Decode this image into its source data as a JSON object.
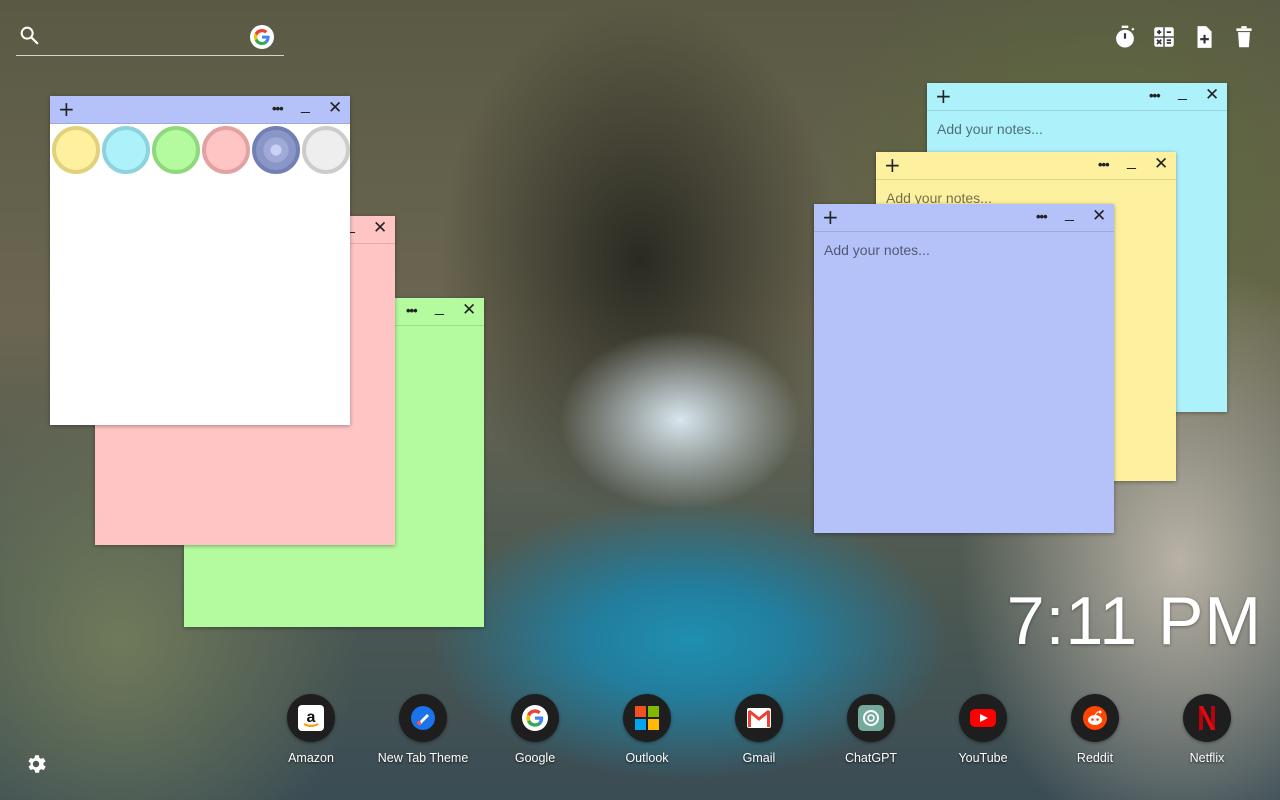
{
  "search": {
    "placeholder": "",
    "icon": "search-icon",
    "engine_icon": "google-icon"
  },
  "toolbar": [
    {
      "name": "timer",
      "icon": "stopwatch-icon"
    },
    {
      "name": "calculator",
      "icon": "calculator-icon"
    },
    {
      "name": "new-note",
      "icon": "new-file-icon"
    },
    {
      "name": "delete",
      "icon": "trash-icon"
    }
  ],
  "notes": {
    "placeholder": "Add your notes...",
    "add_label": "+",
    "more_label": "•••",
    "minimize_label": "_",
    "close_label": "✕",
    "colors": {
      "white": "#ffffff",
      "pink": "#ffc4c4",
      "green": "#b4fba0",
      "cyan": "#adf1fb",
      "yellow": "#fdf1a0",
      "blue": "#b5c2fa"
    }
  },
  "palette": [
    {
      "name": "yellow",
      "fill": "#fdf1a0",
      "ring": "#e0d27a"
    },
    {
      "name": "cyan",
      "fill": "#adf1fb",
      "ring": "#8cd3de"
    },
    {
      "name": "green",
      "fill": "#b4fba0",
      "ring": "#8fd87e"
    },
    {
      "name": "pink",
      "fill": "#ffc4c4",
      "ring": "#e3a2a2"
    },
    {
      "name": "blue",
      "fill": "#8a96c8",
      "ring": "#7380b4",
      "selected": true
    },
    {
      "name": "gray",
      "fill": "#eeeeee",
      "ring": "#cccccc"
    }
  ],
  "clock": {
    "time": "7:11 PM"
  },
  "dock": [
    {
      "label": "Amazon",
      "icon": "amazon-icon"
    },
    {
      "label": "New Tab Theme",
      "icon": "new-tab-theme-icon"
    },
    {
      "label": "Google",
      "icon": "google-icon"
    },
    {
      "label": "Outlook",
      "icon": "microsoft-icon"
    },
    {
      "label": "Gmail",
      "icon": "gmail-icon"
    },
    {
      "label": "ChatGPT",
      "icon": "chatgpt-icon"
    },
    {
      "label": "YouTube",
      "icon": "youtube-icon"
    },
    {
      "label": "Reddit",
      "icon": "reddit-icon"
    },
    {
      "label": "Netflix",
      "icon": "netflix-icon"
    }
  ],
  "settings": {
    "icon": "gear-icon"
  }
}
